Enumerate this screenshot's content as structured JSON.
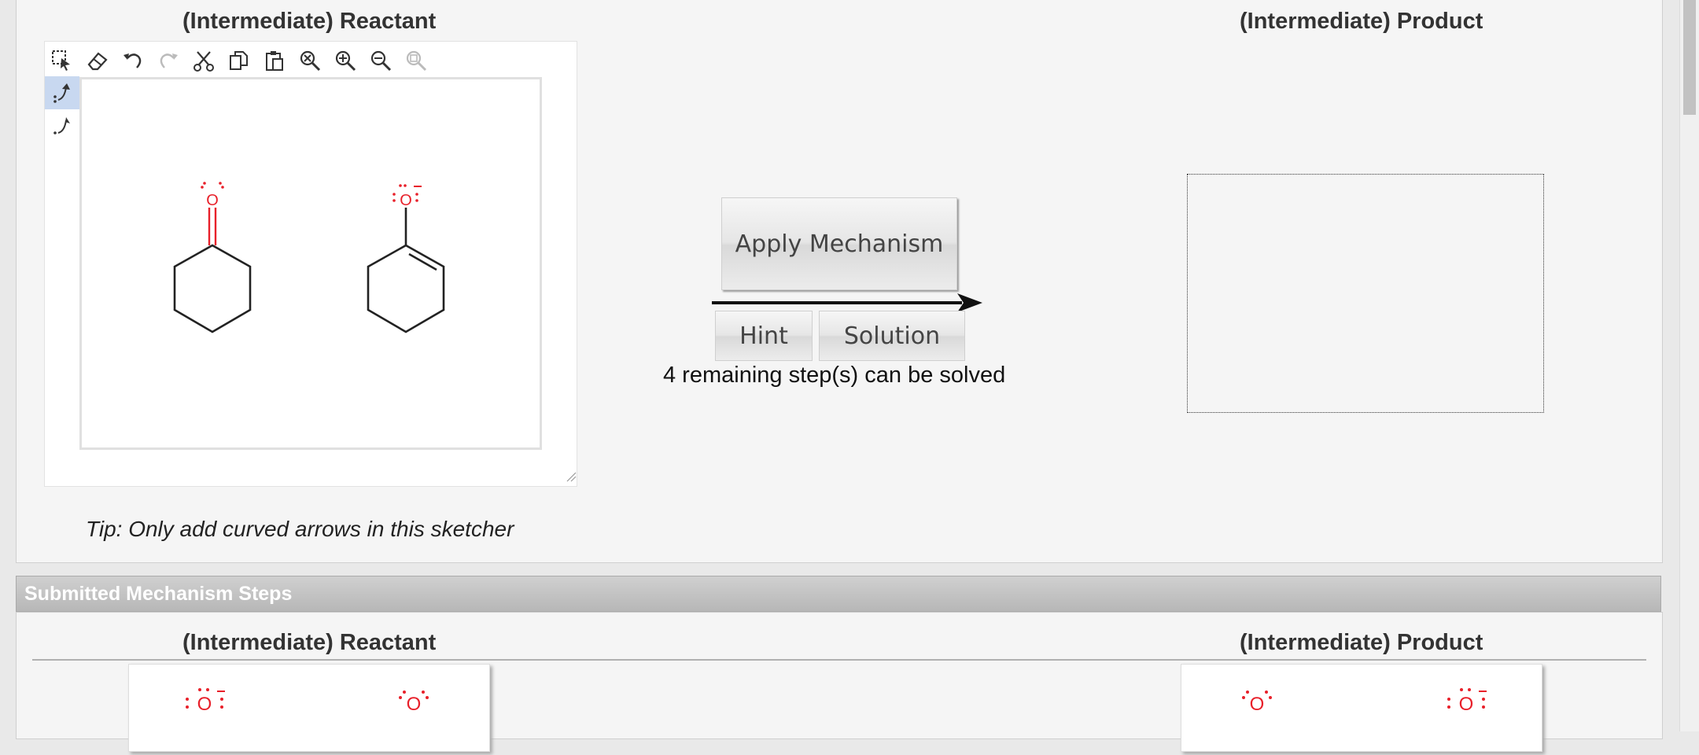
{
  "main": {
    "reactant_title": "(Intermediate) Reactant",
    "product_title": "(Intermediate) Product",
    "tip": "Tip: Only add curved arrows in this sketcher",
    "apply_label": "Apply Mechanism",
    "hint_label": "Hint",
    "solution_label": "Solution",
    "remaining_text": "4 remaining step(s) can be solved",
    "oxygen_label": "O"
  },
  "toolbar": {
    "tools": [
      "select-icon",
      "eraser-icon",
      "undo-icon",
      "redo-icon",
      "cut-icon",
      "copy-icon",
      "paste-icon",
      "zoom-reset-icon",
      "zoom-in-icon",
      "zoom-out-icon",
      "zoom-fit-icon"
    ],
    "left_tools": [
      "curved-arrow-electron-pair-icon",
      "curved-arrow-single-electron-icon"
    ]
  },
  "submitted": {
    "header": "Submitted Mechanism Steps",
    "reactant_title": "(Intermediate) Reactant",
    "product_title": "(Intermediate) Product",
    "oxygen_label": "O"
  },
  "colors": {
    "accent_red": "#e8202a",
    "active_tool": "#c8d8f0",
    "header_gray": "#bdbdbd"
  }
}
